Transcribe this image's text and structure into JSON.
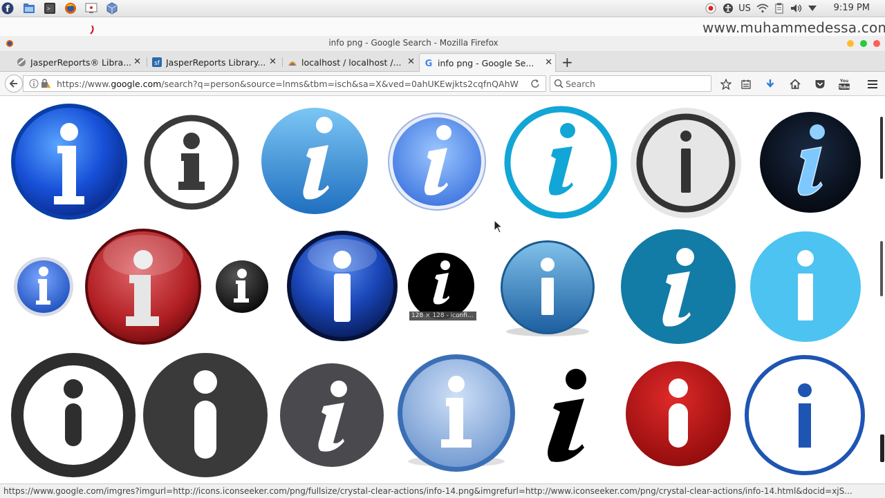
{
  "os_panel": {
    "keyboard_layout": "US",
    "clock": "9:19 PM",
    "launchers": [
      "fedora-menu-icon",
      "files-icon",
      "terminal-icon",
      "firefox-icon",
      "screen-icon",
      "box-icon"
    ]
  },
  "watermark": "www.muhammedessa.com",
  "window": {
    "title": "info png - Google Search - Mozilla Firefox"
  },
  "tabs": [
    {
      "label": "JasperReports® Libra...",
      "active": false
    },
    {
      "label": "JasperReports Library...",
      "active": false
    },
    {
      "label": "localhost / localhost /...",
      "active": false
    },
    {
      "label": "info png - Google Se...",
      "active": true
    }
  ],
  "navbar": {
    "url_prefix": "https://www.",
    "url_domain": "google.com",
    "url_rest": "/search?q=person&source=lnms&tbm=isch&sa=X&ved=0ahUKEwjkts2cqfnQAhW",
    "search_placeholder": "Search"
  },
  "colors": {
    "accent_blue": "#1a73e8",
    "firefox_download": "#2b7bd9",
    "close_red": "#ff5f57",
    "min_yellow": "#ffbd2e",
    "max_green": "#28c940"
  },
  "results": {
    "hover_tooltip": "128 × 128 - iconfi..."
  },
  "status_url": "https://www.google.com/imgres?imgurl=http://icons.iconseeker.com/png/fullsize/crystal-clear-actions/info-14.png&imgrefurl=http://www.iconseeker.com/png/crystal-clear-actions/info-14.html&docid=xjS..."
}
